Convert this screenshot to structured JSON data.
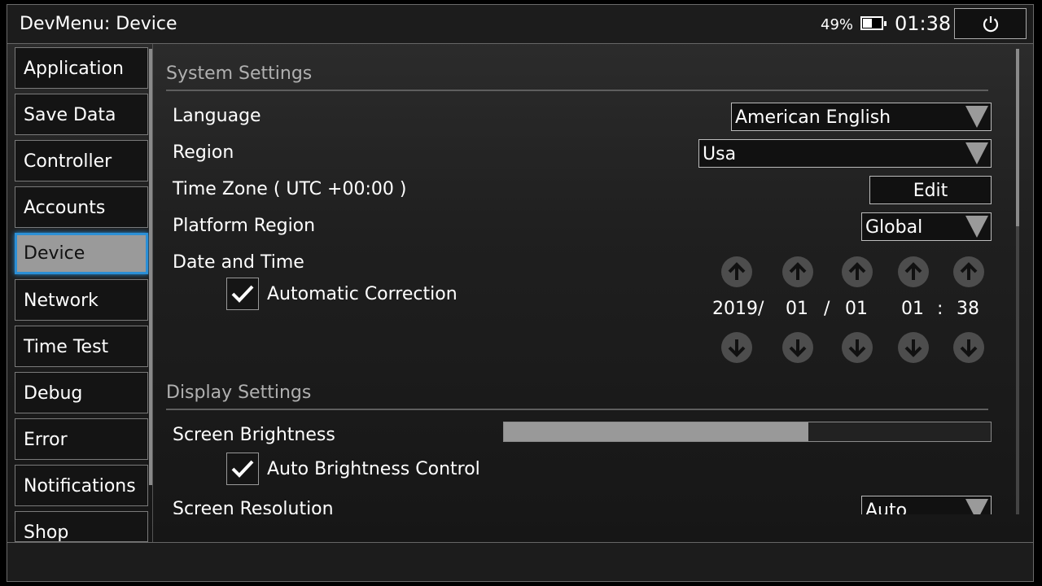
{
  "header": {
    "title": "DevMenu: Device",
    "battery_percent": "49%",
    "battery_level": 0.49,
    "clock": "01:38",
    "power_icon": "power-icon"
  },
  "sidebar": {
    "items": [
      {
        "label": "Application",
        "active": false
      },
      {
        "label": "Save Data",
        "active": false
      },
      {
        "label": "Controller",
        "active": false
      },
      {
        "label": "Accounts",
        "active": false
      },
      {
        "label": "Device",
        "active": true
      },
      {
        "label": "Network",
        "active": false
      },
      {
        "label": "Time Test",
        "active": false
      },
      {
        "label": "Debug",
        "active": false
      },
      {
        "label": "Error",
        "active": false
      },
      {
        "label": "Notifications",
        "active": false
      },
      {
        "label": "Shop",
        "active": false
      }
    ]
  },
  "system_settings": {
    "heading": "System Settings",
    "language": {
      "label": "Language",
      "value": "American English"
    },
    "region": {
      "label": "Region",
      "value": "Usa"
    },
    "time_zone": {
      "label": "Time Zone ( UTC +00:00 )",
      "button": "Edit"
    },
    "platform_region": {
      "label": "Platform Region",
      "value": "Global"
    },
    "date_time": {
      "label": "Date and Time",
      "auto_correction": {
        "label": "Automatic Correction",
        "checked": true
      },
      "year": "2019/",
      "month": "01",
      "sep": "/",
      "day": "01",
      "hour": "01",
      "colon": ":",
      "minute": "38"
    }
  },
  "display_settings": {
    "heading": "Display Settings",
    "brightness": {
      "label": "Screen Brightness",
      "level": 0.625
    },
    "auto_brightness": {
      "label": "Auto Brightness Control",
      "checked": true
    },
    "resolution": {
      "label": "Screen Resolution",
      "value": "Auto"
    }
  },
  "colors": {
    "accent": "#2b8fd6",
    "background": "#1f1f1f"
  }
}
